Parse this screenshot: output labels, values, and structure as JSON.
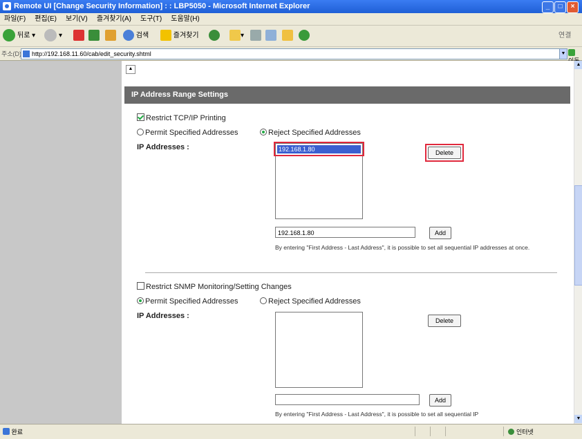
{
  "window": {
    "title": "Remote UI [Change Security Information] : : LBP5050 - Microsoft Internet Explorer",
    "min": "_",
    "max": "□",
    "close": "×"
  },
  "menu": [
    "파일(F)",
    "편집(E)",
    "보기(V)",
    "즐겨찾기(A)",
    "도구(T)",
    "도움말(H)"
  ],
  "toolbar": {
    "back": "뒤로",
    "search": "검색",
    "favorites": "즐겨찾기",
    "links": "연결"
  },
  "address": {
    "label": "주소(D)",
    "url": "http://192.168.11.60/cab/edit_security.shtml",
    "go": "이동"
  },
  "main": {
    "collapse_icon": "▲",
    "section_title": "IP Address Range Settings",
    "tcpip": {
      "checkbox_label": "Restrict TCP/IP Printing",
      "checked": true,
      "radio_permit": "Permit Specified Addresses",
      "radio_reject": "Reject Specified Addresses",
      "selected": "reject",
      "ip_label": "IP Addresses :",
      "list_items": [
        "192.168.1.80"
      ],
      "delete_button": "Delete",
      "input_value": "192.168.1.80",
      "add_button": "Add",
      "note": "By entering \"First Address - Last Address\", it is possible to set all sequential IP addresses at once."
    },
    "snmp": {
      "checkbox_label": "Restrict SNMP Monitoring/Setting Changes",
      "checked": false,
      "radio_permit": "Permit Specified Addresses",
      "radio_reject": "Reject Specified Addresses",
      "selected": "permit",
      "ip_label": "IP Addresses :",
      "delete_button": "Delete",
      "input_value": "",
      "add_button": "Add",
      "note": "By entering \"First Address - Last Address\", it is possible to set all sequential IP"
    }
  },
  "status": {
    "left": "완료",
    "zone": "인터넷"
  },
  "colors": {
    "highlight": "#e0283c",
    "section_header": "#6a6a6a",
    "left_panel": "#c8c8c8"
  }
}
